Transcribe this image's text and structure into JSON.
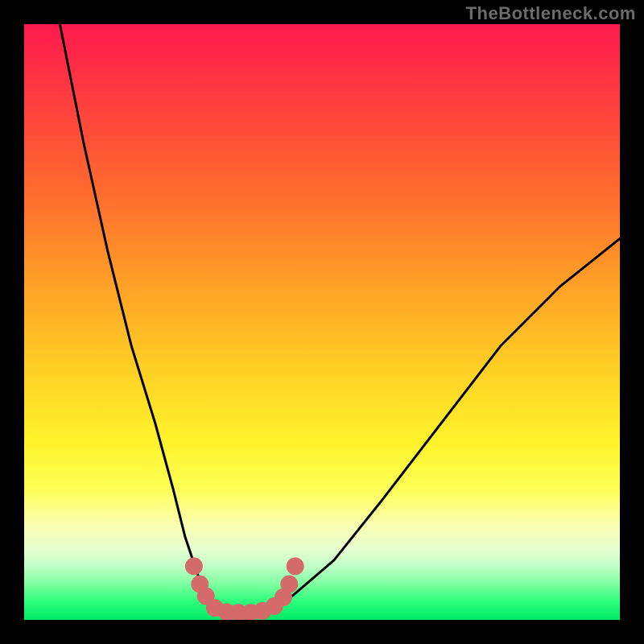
{
  "watermark": "TheBottleneck.com",
  "chart_data": {
    "type": "line",
    "title": "",
    "xlabel": "",
    "ylabel": "",
    "xlim": [
      0,
      100
    ],
    "ylim": [
      0,
      100
    ],
    "note": "Bottleneck-style V-curve over a red-to-green vertical gradient. Axes are unlabeled in the source image; x and values are normalized 0-100. Lower y = closer to bottom (green / optimal).",
    "series": [
      {
        "name": "curve",
        "x": [
          6,
          10,
          14,
          18,
          22,
          25,
          27,
          29,
          30.5,
          32,
          33.5,
          36,
          40,
          45,
          52,
          60,
          70,
          80,
          90,
          100
        ],
        "values": [
          100,
          80,
          62,
          46,
          33,
          22,
          14,
          8,
          4,
          1.5,
          1,
          1,
          1.5,
          4,
          10,
          20,
          33,
          46,
          56,
          64
        ]
      }
    ],
    "markers": {
      "name": "highlight-dots",
      "color": "#d46a6a",
      "points": [
        {
          "x": 28.5,
          "y": 9
        },
        {
          "x": 29.5,
          "y": 6
        },
        {
          "x": 30.5,
          "y": 4
        },
        {
          "x": 32,
          "y": 2
        },
        {
          "x": 34,
          "y": 1.3
        },
        {
          "x": 36,
          "y": 1.2
        },
        {
          "x": 38,
          "y": 1.2
        },
        {
          "x": 40,
          "y": 1.5
        },
        {
          "x": 42,
          "y": 2.3
        },
        {
          "x": 43.5,
          "y": 3.8
        },
        {
          "x": 44.5,
          "y": 6
        },
        {
          "x": 45.5,
          "y": 9
        }
      ]
    }
  }
}
